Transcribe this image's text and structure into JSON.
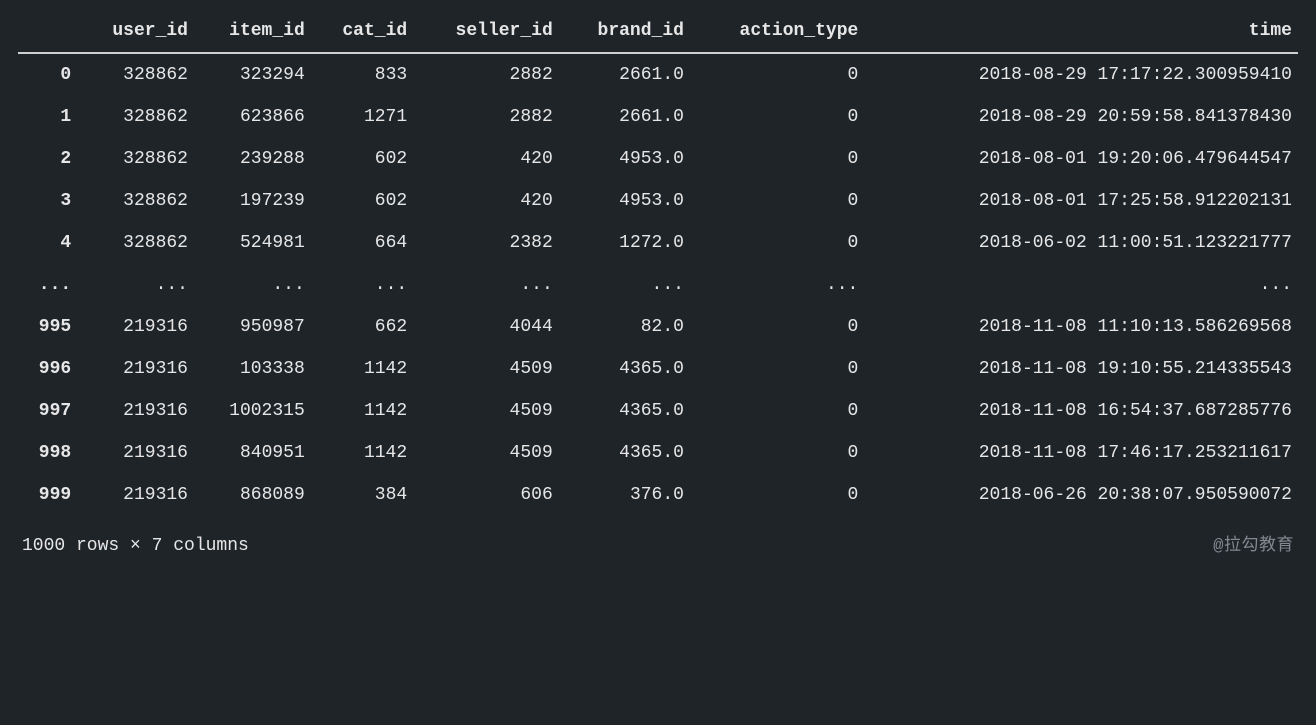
{
  "columns": [
    "user_id",
    "item_id",
    "cat_id",
    "seller_id",
    "brand_id",
    "action_type",
    "time"
  ],
  "index_header": "",
  "rows": [
    {
      "idx": "0",
      "user_id": "328862",
      "item_id": "323294",
      "cat_id": "833",
      "seller_id": "2882",
      "brand_id": "2661.0",
      "action_type": "0",
      "time": "2018-08-29 17:17:22.300959410"
    },
    {
      "idx": "1",
      "user_id": "328862",
      "item_id": "623866",
      "cat_id": "1271",
      "seller_id": "2882",
      "brand_id": "2661.0",
      "action_type": "0",
      "time": "2018-08-29 20:59:58.841378430"
    },
    {
      "idx": "2",
      "user_id": "328862",
      "item_id": "239288",
      "cat_id": "602",
      "seller_id": "420",
      "brand_id": "4953.0",
      "action_type": "0",
      "time": "2018-08-01 19:20:06.479644547"
    },
    {
      "idx": "3",
      "user_id": "328862",
      "item_id": "197239",
      "cat_id": "602",
      "seller_id": "420",
      "brand_id": "4953.0",
      "action_type": "0",
      "time": "2018-08-01 17:25:58.912202131"
    },
    {
      "idx": "4",
      "user_id": "328862",
      "item_id": "524981",
      "cat_id": "664",
      "seller_id": "2382",
      "brand_id": "1272.0",
      "action_type": "0",
      "time": "2018-06-02 11:00:51.123221777"
    },
    {
      "idx": "...",
      "user_id": "...",
      "item_id": "...",
      "cat_id": "...",
      "seller_id": "...",
      "brand_id": "...",
      "action_type": "...",
      "time": "..."
    },
    {
      "idx": "995",
      "user_id": "219316",
      "item_id": "950987",
      "cat_id": "662",
      "seller_id": "4044",
      "brand_id": "82.0",
      "action_type": "0",
      "time": "2018-11-08 11:10:13.586269568"
    },
    {
      "idx": "996",
      "user_id": "219316",
      "item_id": "103338",
      "cat_id": "1142",
      "seller_id": "4509",
      "brand_id": "4365.0",
      "action_type": "0",
      "time": "2018-11-08 19:10:55.214335543"
    },
    {
      "idx": "997",
      "user_id": "219316",
      "item_id": "1002315",
      "cat_id": "1142",
      "seller_id": "4509",
      "brand_id": "4365.0",
      "action_type": "0",
      "time": "2018-11-08 16:54:37.687285776"
    },
    {
      "idx": "998",
      "user_id": "219316",
      "item_id": "840951",
      "cat_id": "1142",
      "seller_id": "4509",
      "brand_id": "4365.0",
      "action_type": "0",
      "time": "2018-11-08 17:46:17.253211617"
    },
    {
      "idx": "999",
      "user_id": "219316",
      "item_id": "868089",
      "cat_id": "384",
      "seller_id": "606",
      "brand_id": "376.0",
      "action_type": "0",
      "time": "2018-06-26 20:38:07.950590072"
    }
  ],
  "footer": "1000 rows × 7 columns",
  "watermark": "@拉勾教育"
}
